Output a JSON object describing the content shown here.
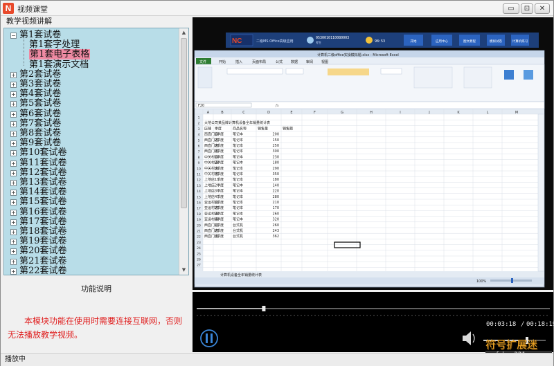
{
  "window": {
    "title": "视频课堂",
    "buttons": {
      "minimize": "▭",
      "restore": "⊡",
      "close": "✕"
    }
  },
  "menu": {
    "label": "教学视频讲解"
  },
  "tree": {
    "root": "第1套试卷",
    "children": [
      "第1套字处理",
      "第1套电子表格",
      "第1套演示文档"
    ],
    "selected_index": 1,
    "items": [
      "第2套试卷",
      "第3套试卷",
      "第4套试卷",
      "第5套试卷",
      "第6套试卷",
      "第7套试卷",
      "第8套试卷",
      "第9套试卷",
      "第10套试卷",
      "第11套试卷",
      "第12套试卷",
      "第13套试卷",
      "第14套试卷",
      "第15套试卷",
      "第16套试卷",
      "第17套试卷",
      "第18套试卷",
      "第19套试卷",
      "第20套试卷",
      "第21套试卷",
      "第22套试卷"
    ]
  },
  "info": {
    "title": "功能说明",
    "message": "本模块功能在使用时需要连接互联网，否则无法播放教学视频。"
  },
  "status": {
    "text": "播放中"
  },
  "player": {
    "time_current": "00:03:18",
    "time_total": "00:18:19",
    "progress": 0.19,
    "volume": 0.7
  },
  "watermark": {
    "line1": "符号扩展迷",
    "line2": "fuhao321.com"
  },
  "excel": {
    "title": "计算机二级office实操模拟题.xlsx - Microsoft Excel",
    "tabs": [
      "文件",
      "开始",
      "插入",
      "页面布局",
      "公式",
      "数据",
      "审阅",
      "视图"
    ],
    "namebox": "F20",
    "fx": "fx",
    "columns": [
      "A",
      "B",
      "C",
      "D",
      "E",
      "F",
      "G",
      "H",
      "I",
      "J",
      "K",
      "L",
      "M"
    ],
    "sheet_title": "大地公司某品牌计算机设备全年销量统计表",
    "headers": [
      "店铺",
      "季度",
      "商品名称",
      "销售量",
      "销售额"
    ],
    "rows": [
      [
        "西直门店",
        "1季度",
        "笔记本",
        "200",
        ""
      ],
      [
        "西直门店",
        "2季度",
        "笔记本",
        "150",
        ""
      ],
      [
        "西直门店",
        "3季度",
        "笔记本",
        "250",
        ""
      ],
      [
        "西直门店",
        "4季度",
        "笔记本",
        "300",
        ""
      ],
      [
        "中关村店",
        "1季度",
        "笔记本",
        "230",
        ""
      ],
      [
        "中关村店",
        "2季度",
        "笔记本",
        "180",
        ""
      ],
      [
        "中关村店",
        "3季度",
        "笔记本",
        "290",
        ""
      ],
      [
        "中关村店",
        "4季度",
        "笔记本",
        "350",
        ""
      ],
      [
        "上地店",
        "1季度",
        "笔记本",
        "180",
        ""
      ],
      [
        "上地店",
        "2季度",
        "笔记本",
        "140",
        ""
      ],
      [
        "上地店",
        "3季度",
        "笔记本",
        "220",
        ""
      ],
      [
        "上地店",
        "4季度",
        "笔记本",
        "280",
        ""
      ],
      [
        "亚运村店",
        "1季度",
        "笔记本",
        "210",
        ""
      ],
      [
        "亚运村店",
        "2季度",
        "笔记本",
        "170",
        ""
      ],
      [
        "亚运村店",
        "3季度",
        "笔记本",
        "260",
        ""
      ],
      [
        "亚运村店",
        "4季度",
        "笔记本",
        "320",
        ""
      ],
      [
        "西直门店",
        "1季度",
        "台式机",
        "260",
        ""
      ],
      [
        "西直门店",
        "2季度",
        "台式机",
        "243",
        ""
      ],
      [
        "西直门店",
        "3季度",
        "台式机",
        "362",
        ""
      ]
    ],
    "sheet_tab": "计算机设备全年销量统计表",
    "zoom": "100%",
    "topbar": [
      "开始",
      "应用中心",
      "图文教程",
      "模拟试卷",
      "计算机练习"
    ]
  }
}
